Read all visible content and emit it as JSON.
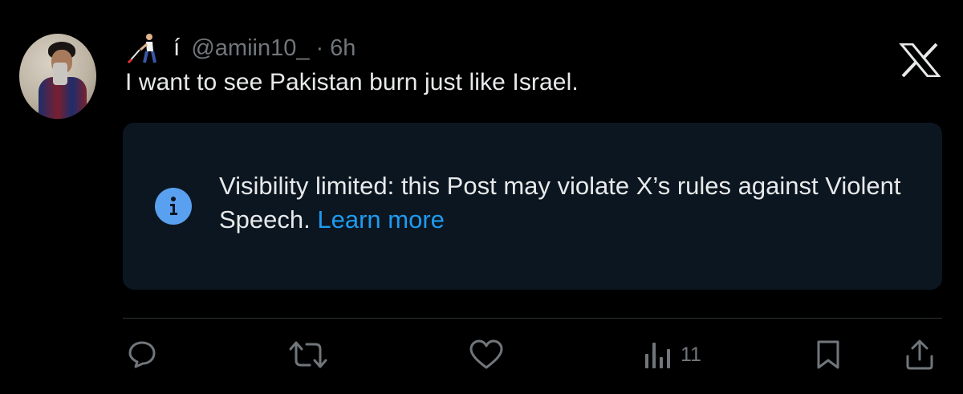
{
  "post": {
    "display_name_icon": "person-with-white-cane-emoji-icon",
    "display_name_glyph": "í",
    "handle": "@amiin10_",
    "separator": "·",
    "time": "6h",
    "text": "I want to see Pakistan burn just like Israel."
  },
  "notice": {
    "icon": "info-icon",
    "message": "Visibility limited: this Post may violate X’s rules against Violent Speech.",
    "link": "Learn more"
  },
  "actions": {
    "views": "11"
  },
  "colors": {
    "background": "#000000",
    "notice_background": "#0c1620",
    "text_primary": "#e7e9ea",
    "text_secondary": "#71767b",
    "link": "#1d9bf0",
    "info_icon": "#5aa0f0"
  }
}
